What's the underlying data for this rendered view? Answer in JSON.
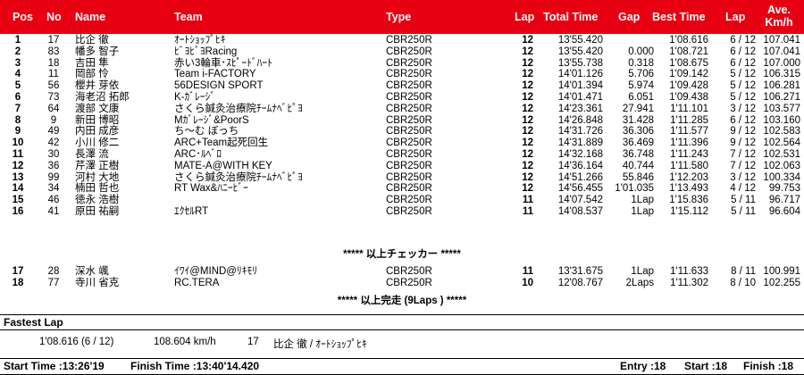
{
  "header": {
    "pos": "Pos",
    "no": "No",
    "name": "Name",
    "team": "Team",
    "type": "Type",
    "lap": "Lap",
    "total_time": "Total Time",
    "gap": "Gap",
    "best_time": "Best Time",
    "best_lap": "Lap",
    "ave_line1": "Ave.",
    "ave_line2": "Km/h"
  },
  "rows": [
    {
      "pos": "1",
      "no": "17",
      "name": "比企 徹",
      "team": "ｵｰﾄｼｮｯﾌﾟﾋｷ",
      "type": "CBR250R",
      "lap": "12",
      "time": "13'55.420",
      "gap": "",
      "best": "1'08.616",
      "best_lap": "6 / 12",
      "ave": "107.041"
    },
    {
      "pos": "2",
      "no": "83",
      "name": "幡多 智子",
      "team": "ﾋﾞﾖﾋﾞﾖRacing",
      "type": "CBR250R",
      "lap": "12",
      "time": "13'55.420",
      "gap": "0.000",
      "best": "1'08.721",
      "best_lap": "6 / 12",
      "ave": "107.041"
    },
    {
      "pos": "3",
      "no": "18",
      "name": "吉田 隼",
      "team": "赤い3輪車･ｽﾋﾟｰﾄﾞﾊｰﾄ",
      "type": "CBR250R",
      "lap": "12",
      "time": "13'55.738",
      "gap": "0.318",
      "best": "1'08.675",
      "best_lap": "6 / 12",
      "ave": "107.000"
    },
    {
      "pos": "4",
      "no": "11",
      "name": "岡部 怜",
      "team": "Team i-FACTORY",
      "type": "CBR250R",
      "lap": "12",
      "time": "14'01.126",
      "gap": "5.706",
      "best": "1'09.142",
      "best_lap": "5 / 12",
      "ave": "106.315"
    },
    {
      "pos": "5",
      "no": "56",
      "name": "櫻井 芽依",
      "team": "56DESIGN SPORT",
      "type": "CBR250R",
      "lap": "12",
      "time": "14'01.394",
      "gap": "5.974",
      "best": "1'09.428",
      "best_lap": "5 / 12",
      "ave": "106.281"
    },
    {
      "pos": "6",
      "no": "73",
      "name": "海老沼 拓郎",
      "team": "K-ｶﾞﾚｰｼﾞ",
      "type": "CBR250R",
      "lap": "12",
      "time": "14'01.471",
      "gap": "6.051",
      "best": "1'09.438",
      "best_lap": "5 / 12",
      "ave": "106.271"
    },
    {
      "pos": "7",
      "no": "64",
      "name": "渡部 文康",
      "team": "さくら鍼灸治療院ﾁｰﾑﾅﾍﾞﾋﾟﾖ",
      "type": "CBR250R",
      "lap": "12",
      "time": "14'23.361",
      "gap": "27.941",
      "best": "1'11.101",
      "best_lap": "3 / 12",
      "ave": "103.577"
    },
    {
      "pos": "8",
      "no": "9",
      "name": "新田 博昭",
      "team": "Mｶﾞﾚｰｼﾞ&PoorS",
      "type": "CBR250R",
      "lap": "12",
      "time": "14'26.848",
      "gap": "31.428",
      "best": "1'11.285",
      "best_lap": "6 / 12",
      "ave": "103.160"
    },
    {
      "pos": "9",
      "no": "49",
      "name": "内田 成彦",
      "team": "ち～む ぼっち",
      "type": "CBR250R",
      "lap": "12",
      "time": "14'31.726",
      "gap": "36.306",
      "best": "1'11.577",
      "best_lap": "9 / 12",
      "ave": "102.583"
    },
    {
      "pos": "10",
      "no": "42",
      "name": "小川 修二",
      "team": "ARC+Team起死回生",
      "type": "CBR250R",
      "lap": "12",
      "time": "14'31.889",
      "gap": "36.469",
      "best": "1'11.396",
      "best_lap": "9 / 12",
      "ave": "102.564"
    },
    {
      "pos": "11",
      "no": "30",
      "name": "長澤 流",
      "team": "ARC･ﾙﾍﾞﾛ",
      "type": "CBR250R",
      "lap": "12",
      "time": "14'32.168",
      "gap": "36.748",
      "best": "1'11.243",
      "best_lap": "7 / 12",
      "ave": "102.531"
    },
    {
      "pos": "12",
      "no": "36",
      "name": "芹澤 正樹",
      "team": "MATE-A@WITH KEY",
      "type": "CBR250R",
      "lap": "12",
      "time": "14'36.164",
      "gap": "40.744",
      "best": "1'11.580",
      "best_lap": "7 / 12",
      "ave": "102.063"
    },
    {
      "pos": "13",
      "no": "99",
      "name": "河村 大地",
      "team": "さくら鍼灸治療院ﾁｰﾑﾅﾍﾞﾋﾟﾖ",
      "type": "CBR250R",
      "lap": "12",
      "time": "14'51.266",
      "gap": "55.846",
      "best": "1'12.203",
      "best_lap": "3 / 12",
      "ave": "100.334"
    },
    {
      "pos": "14",
      "no": "34",
      "name": "楠田 哲也",
      "team": "RT Wax&ﾊﾆｰﾋﾞｰ",
      "type": "CBR250R",
      "lap": "12",
      "time": "14'56.455",
      "gap": "1'01.035",
      "best": "1'13.493",
      "best_lap": "4 / 12",
      "ave": "99.753"
    },
    {
      "pos": "15",
      "no": "46",
      "name": "徳永 浩樹",
      "team": "",
      "type": "CBR250R",
      "lap": "11",
      "time": "14'07.542",
      "gap": "1Lap",
      "best": "1'15.836",
      "best_lap": "5 / 11",
      "ave": "96.717"
    },
    {
      "pos": "16",
      "no": "41",
      "name": "原田 祐嗣",
      "team": "ｴｸｾﾙRT",
      "type": "CBR250R",
      "lap": "11",
      "time": "14'08.537",
      "gap": "1Lap",
      "best": "1'15.112",
      "best_lap": "5 / 11",
      "ave": "96.604"
    }
  ],
  "checker_msg": "***** 以上チェッカー *****",
  "rows_after": [
    {
      "pos": "17",
      "no": "28",
      "name": "深水 颯",
      "team": "ｲﾜｲ@MIND@ﾘｷﾓﾘ",
      "type": "CBR250R",
      "lap": "11",
      "time": "13'31.675",
      "gap": "1Lap",
      "best": "1'11.633",
      "best_lap": "8 / 11",
      "ave": "100.991"
    },
    {
      "pos": "18",
      "no": "77",
      "name": "寺川 省克",
      "team": "RC.TERA",
      "type": "CBR250R",
      "lap": "10",
      "time": "12'08.767",
      "gap": "2Laps",
      "best": "1'11.302",
      "best_lap": "8 / 10",
      "ave": "102.255"
    }
  ],
  "finish_msg": "***** 以上完走 (9Laps ) *****",
  "fastest": {
    "label": "Fastest Lap",
    "time": "1'08.616 (6 / 12)",
    "speed": "108.604 km/h",
    "no": "17",
    "rider": "比企 徹 / ｵｰﾄｼｮｯﾌﾟﾋｷ"
  },
  "footer": {
    "start": "Start Time :13:26'19",
    "finish": "Finish Time :13:40'14.420",
    "entry": "Entry :18",
    "started": "Start :18",
    "finished": "Finish :18"
  },
  "colors": {
    "header_bg": "#e60012",
    "header_text": "#ffffff"
  }
}
